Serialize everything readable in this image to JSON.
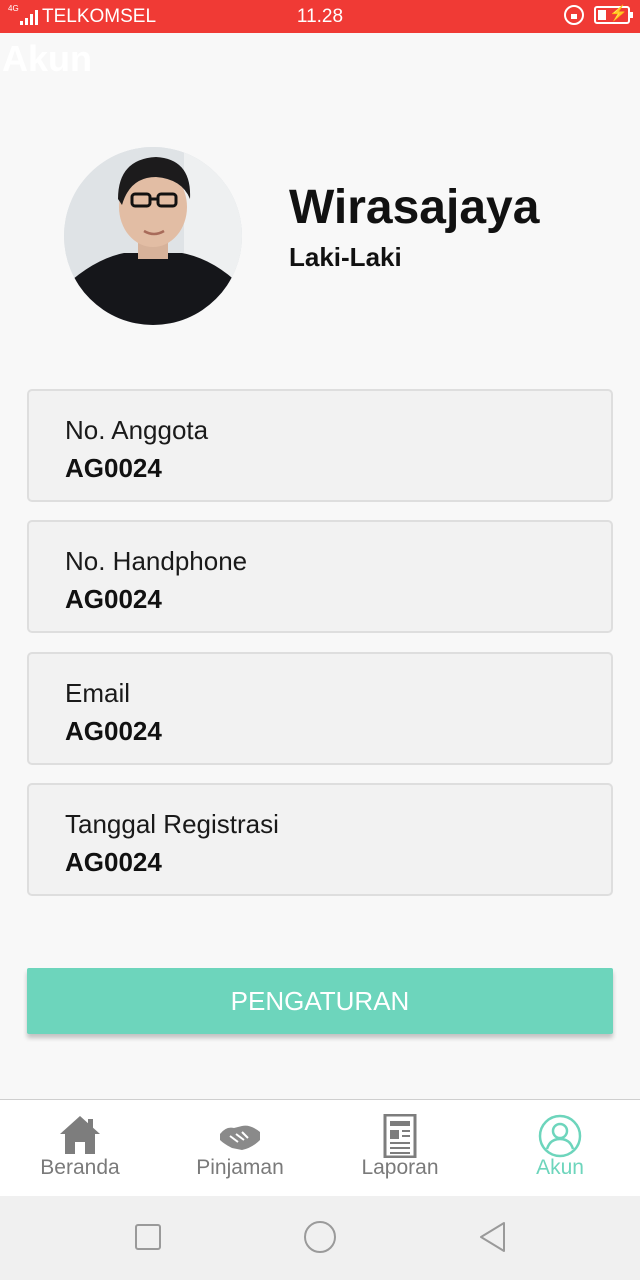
{
  "status_bar": {
    "network": "4G",
    "carrier": "TELKOMSEL",
    "time": "11.28",
    "icons": [
      "signal-icon",
      "rotation-lock-icon",
      "battery-icon"
    ]
  },
  "header": {
    "title": "Akun"
  },
  "profile": {
    "name": "Wirasajaya",
    "gender": "Laki-Laki"
  },
  "info_cards": [
    {
      "label": "No. Anggota",
      "value": "AG0024"
    },
    {
      "label": "No. Handphone",
      "value": "AG0024"
    },
    {
      "label": "Email",
      "value": "AG0024"
    },
    {
      "label": "Tanggal Registrasi",
      "value": "AG0024"
    }
  ],
  "settings_button": {
    "label": "PENGATURAN"
  },
  "bottom_nav": {
    "items": [
      {
        "label": "Beranda",
        "icon": "home-icon"
      },
      {
        "label": "Pinjaman",
        "icon": "handshake-icon"
      },
      {
        "label": "Laporan",
        "icon": "report-icon"
      },
      {
        "label": "Akun",
        "icon": "account-icon",
        "active": true
      }
    ]
  },
  "system_nav": {
    "icons": [
      "recent-apps-icon",
      "home-circle-icon",
      "back-icon"
    ]
  },
  "colors": {
    "status_bar": "#f03a35",
    "accent": "#6dd5bc",
    "card_bg": "#f2f2f2",
    "inactive": "#7a7a7a"
  }
}
